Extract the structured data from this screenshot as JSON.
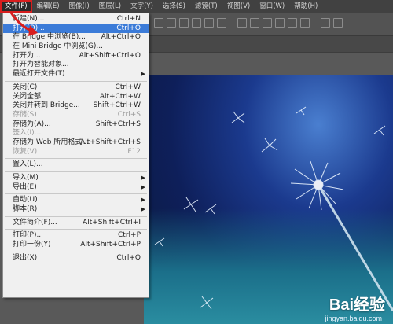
{
  "menubar": {
    "items": [
      "文件(F)",
      "编辑(E)",
      "图像(I)",
      "图层(L)",
      "文字(Y)",
      "选择(S)",
      "滤镜(T)",
      "视图(V)",
      "窗口(W)",
      "帮助(H)"
    ]
  },
  "file_menu": {
    "items": [
      {
        "label": "新建(N)...",
        "shortcut": "Ctrl+N"
      },
      {
        "label": "打开(O)...",
        "shortcut": "Ctrl+O",
        "highlight": true
      },
      {
        "label": "在 Bridge 中浏览(B)...",
        "shortcut": "Alt+Ctrl+O"
      },
      {
        "label": "在 Mini Bridge 中浏览(G)...",
        "shortcut": ""
      },
      {
        "label": "打开为...",
        "shortcut": "Alt+Shift+Ctrl+O"
      },
      {
        "label": "打开为智能对象...",
        "shortcut": ""
      },
      {
        "label": "最近打开文件(T)",
        "shortcut": "",
        "submenu": true
      },
      {
        "separator": true
      },
      {
        "label": "关闭(C)",
        "shortcut": "Ctrl+W"
      },
      {
        "label": "关闭全部",
        "shortcut": "Alt+Ctrl+W"
      },
      {
        "label": "关闭并转到 Bridge...",
        "shortcut": "Shift+Ctrl+W"
      },
      {
        "label": "存储(S)",
        "shortcut": "Ctrl+S",
        "disabled": true
      },
      {
        "label": "存储为(A)...",
        "shortcut": "Shift+Ctrl+S"
      },
      {
        "label": "签入(I)...",
        "shortcut": "",
        "disabled": true
      },
      {
        "label": "存储为 Web 所用格式...",
        "shortcut": "Alt+Shift+Ctrl+S"
      },
      {
        "label": "恢复(V)",
        "shortcut": "F12",
        "disabled": true
      },
      {
        "separator": true
      },
      {
        "label": "置入(L)...",
        "shortcut": ""
      },
      {
        "separator": true
      },
      {
        "label": "导入(M)",
        "shortcut": "",
        "submenu": true
      },
      {
        "label": "导出(E)",
        "shortcut": "",
        "submenu": true
      },
      {
        "separator": true
      },
      {
        "label": "自动(U)",
        "shortcut": "",
        "submenu": true
      },
      {
        "label": "脚本(R)",
        "shortcut": "",
        "submenu": true
      },
      {
        "separator": true
      },
      {
        "label": "文件简介(F)...",
        "shortcut": "Alt+Shift+Ctrl+I"
      },
      {
        "separator": true
      },
      {
        "label": "打印(P)...",
        "shortcut": "Ctrl+P"
      },
      {
        "label": "打印一份(Y)",
        "shortcut": "Alt+Shift+Ctrl+P"
      },
      {
        "separator": true
      },
      {
        "label": "退出(X)",
        "shortcut": "Ctrl+Q"
      }
    ]
  },
  "watermark": {
    "logo": "Bai经验",
    "url": "jingyan.baidu.com"
  },
  "colors": {
    "highlight": "#3b7bd8",
    "annotation": "#d81e1e"
  }
}
